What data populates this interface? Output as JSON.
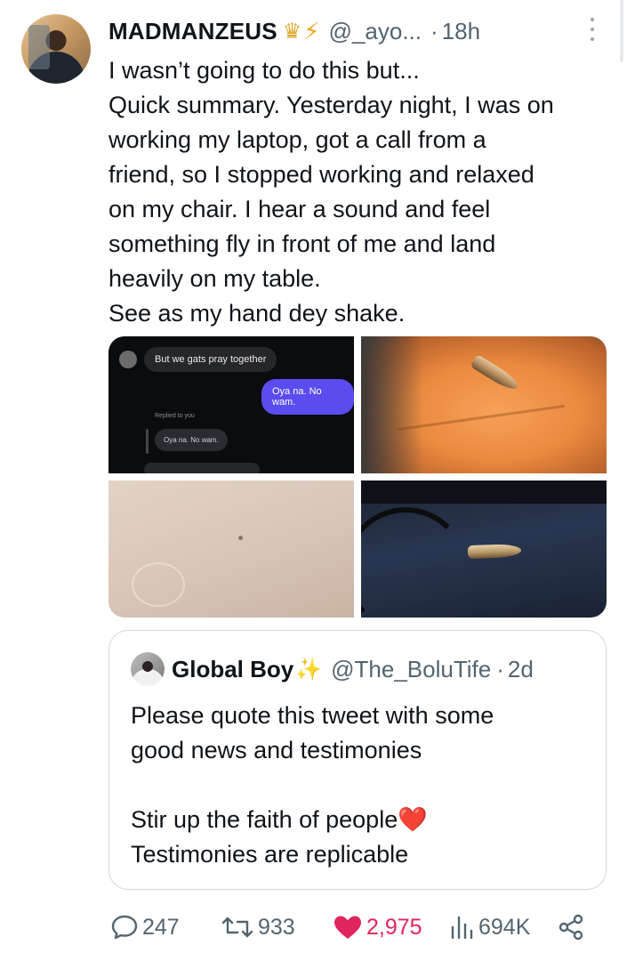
{
  "tweet": {
    "author_name": "MADMANZEUS",
    "badges": [
      "crown-emoji",
      "lightning-emoji"
    ],
    "handle": "@_ayo...",
    "separator": "·",
    "time": "18h",
    "lines": [
      "I wasn’t going to do this but...",
      "Quick summary. Yesterday night, I was on",
      "working my laptop, got a call from a",
      "friend, so I stopped working and relaxed",
      "on my chair. I hear a sound and feel",
      "something fly in front of me and land",
      "heavily on my table.",
      "See as my hand dey shake."
    ]
  },
  "media": {
    "chat": {
      "incoming_message": "But we gats pray together",
      "outgoing_message": "Oya na. No wam.",
      "replied_label": "Replied to you",
      "quoted_message": "Oya na. No wam."
    }
  },
  "quoted_tweet": {
    "author_name": "Global Boy",
    "badge": "sparkles-emoji",
    "handle": "@The_BoluTife",
    "separator": "·",
    "time": "2d",
    "lines": [
      "Please quote this tweet with some",
      "good news and testimonies",
      "",
      "Stir up the faith of people",
      "Testimonies are replicable"
    ],
    "line_emoji": "❤️"
  },
  "actions": {
    "replies": "247",
    "retweets": "933",
    "likes": "2,975",
    "views": "694K"
  },
  "colors": {
    "text": "#0f1419",
    "secondary": "#536471",
    "like": "#e0245e",
    "border": "#cfd9de"
  }
}
